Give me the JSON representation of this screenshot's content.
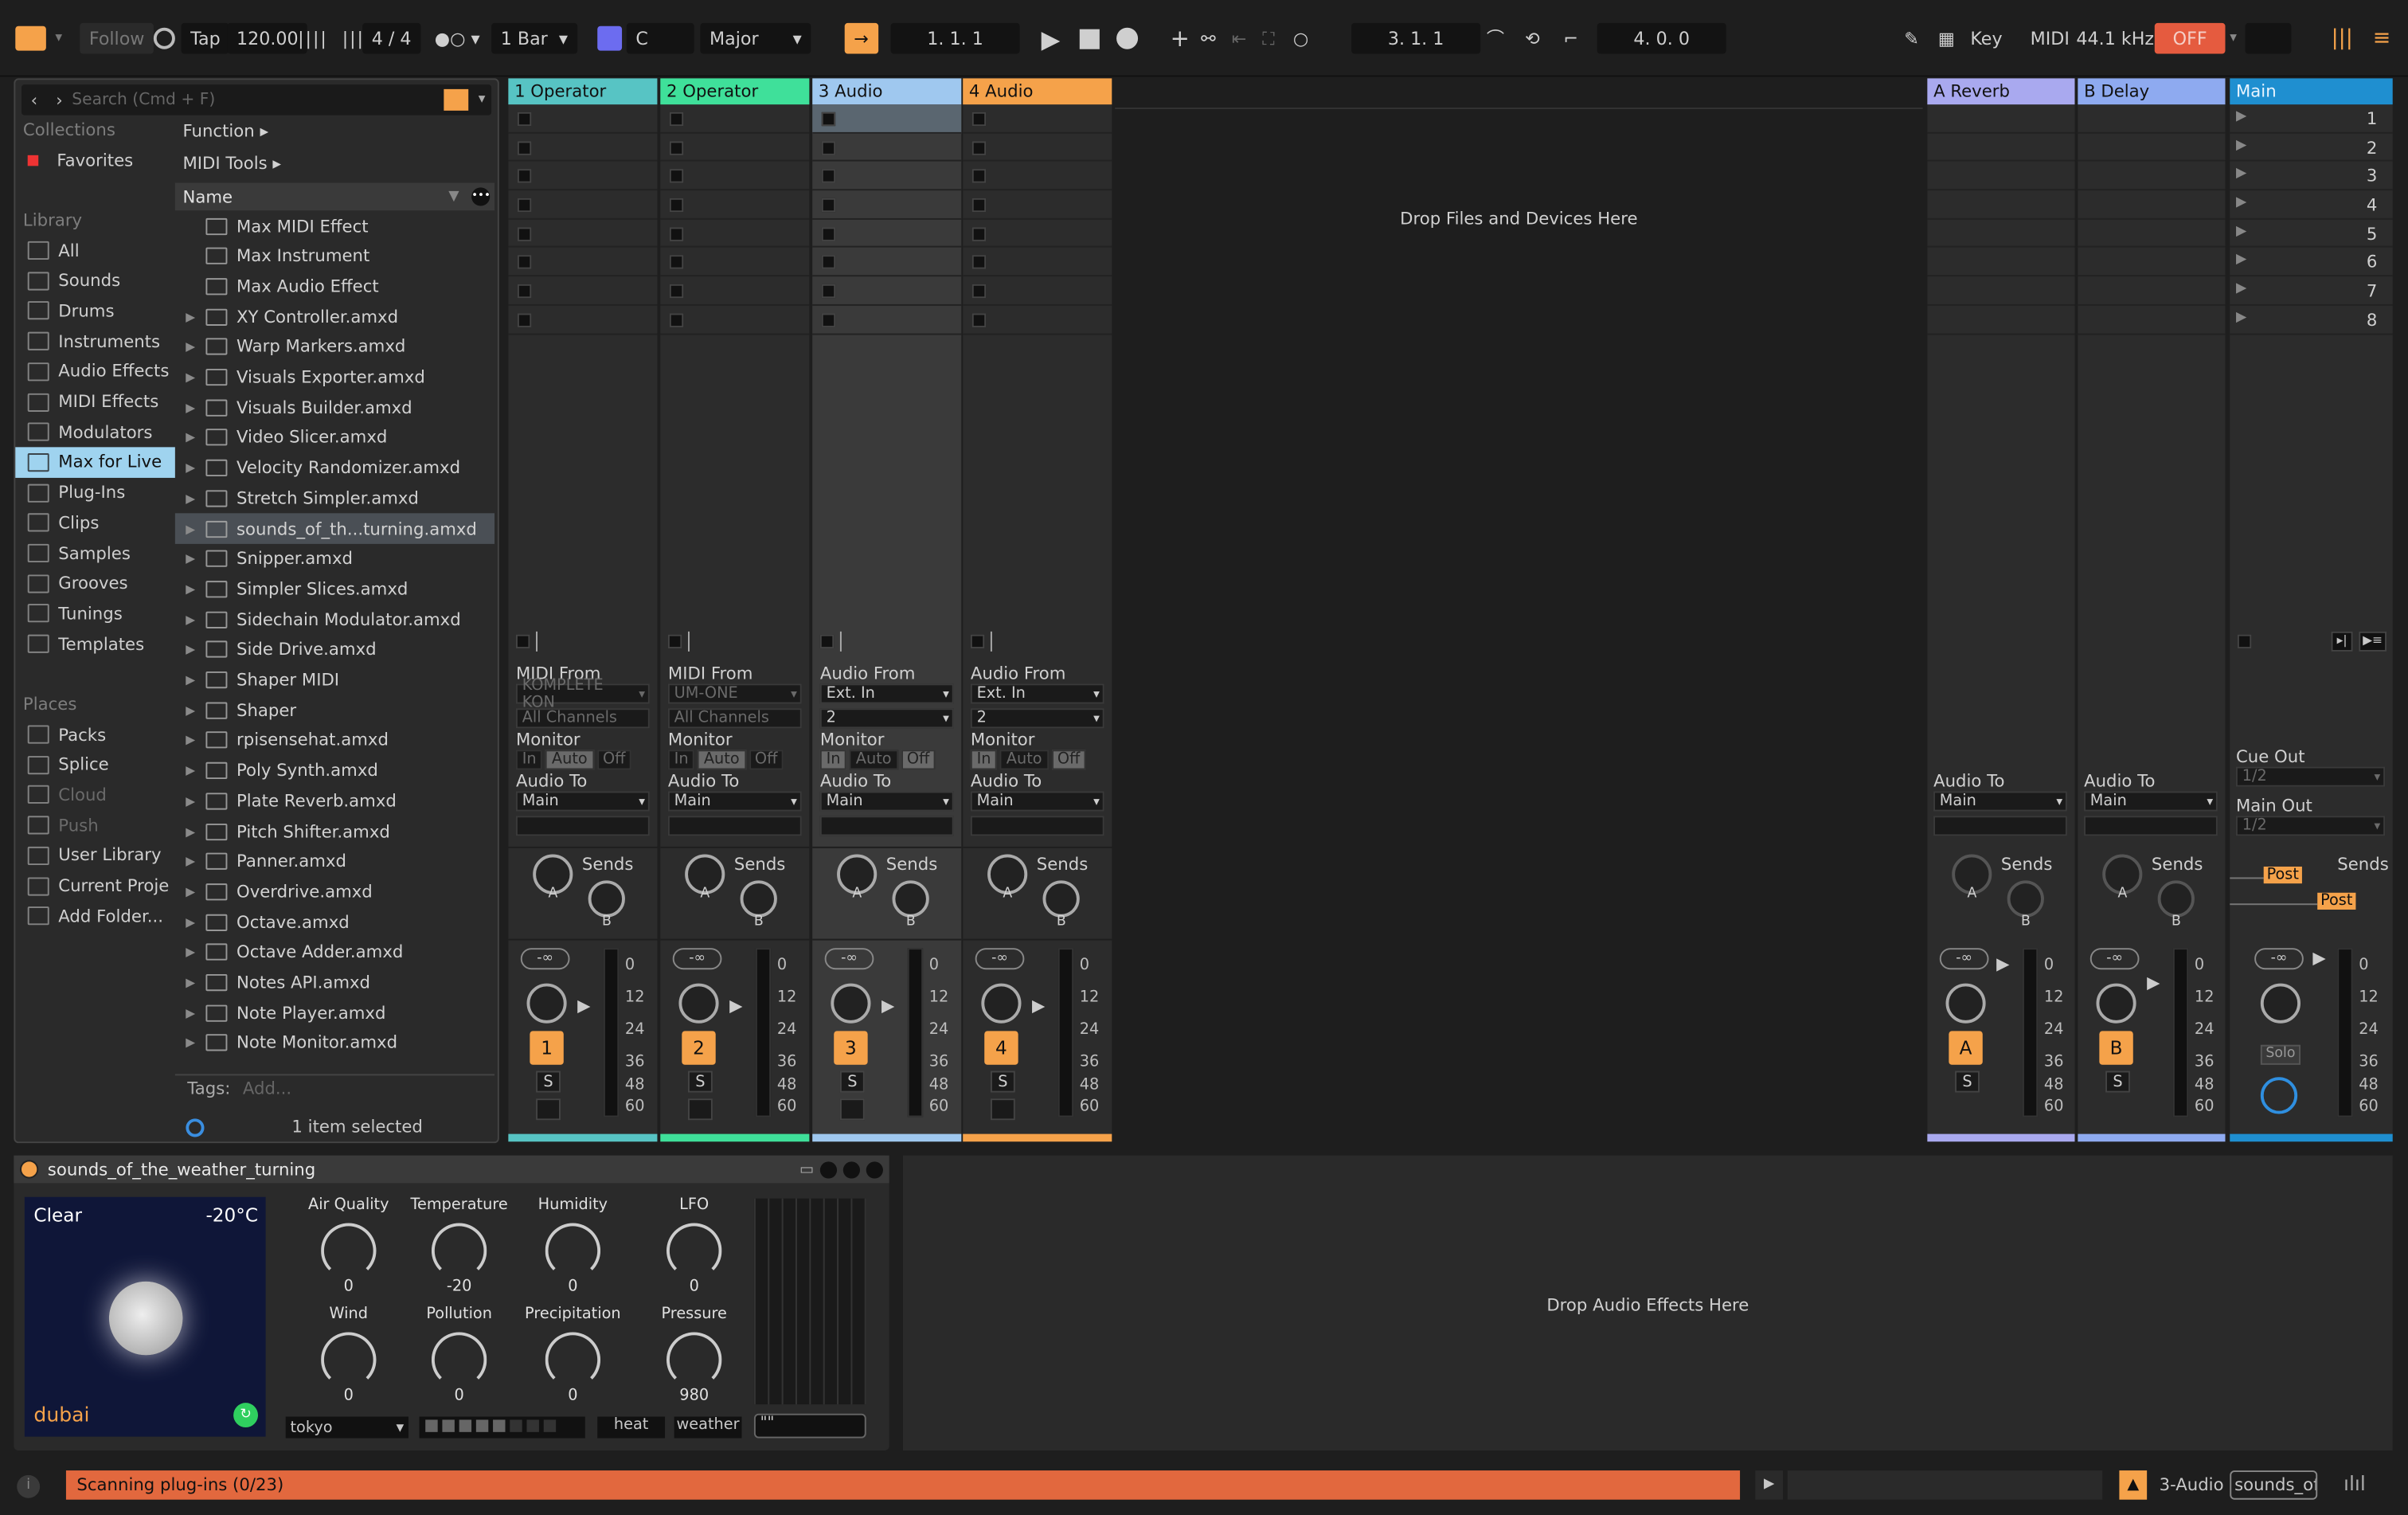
{
  "transport": {
    "follow": "Follow",
    "tap": "Tap",
    "tempo": "120.00",
    "signature": "4 / 4",
    "quantize": "1 Bar",
    "key": "C",
    "scale": "Major",
    "position": "1.  1.  1",
    "loop_start": "3.  1.  1",
    "loop_length": "4.  0.  0",
    "key_label": "Key",
    "midi_label": "MIDI",
    "sample_rate": "44.1 kHz",
    "cpu_label": "OFF"
  },
  "browser": {
    "search_placeholder": "Search (Cmd + F)",
    "collections_header": "Collections",
    "favorites": "Favorites",
    "library_header": "Library",
    "library_items": [
      "All",
      "Sounds",
      "Drums",
      "Instruments",
      "Audio Effects",
      "MIDI Effects",
      "Modulators",
      "Max for Live",
      "Plug-Ins",
      "Clips",
      "Samples",
      "Grooves",
      "Tunings",
      "Templates"
    ],
    "places_header": "Places",
    "places_items": [
      "Packs",
      "Splice",
      "Cloud",
      "Push",
      "User Library",
      "Current Proje",
      "Add Folder..."
    ],
    "filters": [
      "Function ▸",
      "MIDI Tools ▸"
    ],
    "name_header": "Name",
    "files": [
      "Max MIDI Effect",
      "Max Instrument",
      "Max Audio Effect",
      "XY Controller.amxd",
      "Warp Markers.amxd",
      "Visuals Exporter.amxd",
      "Visuals Builder.amxd",
      "Video Slicer.amxd",
      "Velocity Randomizer.amxd",
      "Stretch Simpler.amxd",
      "sounds_of_th...turning.amxd",
      "Snipper.amxd",
      "Simpler Slices.amxd",
      "Sidechain Modulator.amxd",
      "Side Drive.amxd",
      "Shaper MIDI",
      "Shaper",
      "rpisensehat.amxd",
      "Poly Synth.amxd",
      "Plate Reverb.amxd",
      "Pitch Shifter.amxd",
      "Panner.amxd",
      "Overdrive.amxd",
      "Octave.amxd",
      "Octave Adder.amxd",
      "Notes API.amxd",
      "Note Player.amxd",
      "Note Monitor.amxd"
    ],
    "tags_label": "Tags:",
    "tags_placeholder": "Add...",
    "selection_status": "1 item selected"
  },
  "tracks": [
    {
      "name": "1 Operator",
      "color": "#57c4c4",
      "from_label": "MIDI From",
      "from": "KOMPLETE KON",
      "channel": "All Channels",
      "monitor": "Monitor",
      "audio_to_label": "Audio To",
      "audio_to": "Main",
      "num": "1",
      "vol": "-∞"
    },
    {
      "name": "2 Operator",
      "color": "#3fe09a",
      "from_label": "MIDI From",
      "from": "UM-ONE",
      "channel": "All Channels",
      "monitor": "Monitor",
      "audio_to_label": "Audio To",
      "audio_to": "Main",
      "num": "2",
      "vol": "-∞"
    },
    {
      "name": "3 Audio",
      "color": "#9fc8ef",
      "from_label": "Audio From",
      "from": "Ext. In",
      "channel": "2",
      "monitor": "Monitor",
      "audio_to_label": "Audio To",
      "audio_to": "Main",
      "num": "3",
      "vol": "-∞"
    },
    {
      "name": "4 Audio",
      "color": "#f5a24a",
      "from_label": "Audio From",
      "from": "Ext. In",
      "channel": "2",
      "monitor": "Monitor",
      "audio_to_label": "Audio To",
      "audio_to": "Main",
      "num": "4",
      "vol": "-∞"
    }
  ],
  "monitor_opts": [
    "In",
    "Auto",
    "Off"
  ],
  "returns": [
    {
      "name": "A Reverb",
      "color": "#a9a9ef",
      "audio_to_label": "Audio To",
      "audio_to": "Main",
      "num": "A",
      "vol": "-∞"
    },
    {
      "name": "B Delay",
      "color": "#8eaaf0",
      "audio_to_label": "Audio To",
      "audio_to": "Main",
      "num": "B",
      "vol": "-∞"
    }
  ],
  "main": {
    "name": "Main",
    "color": "#1f8fd0",
    "cue_label": "Cue Out",
    "cue": "1/2",
    "main_label": "Main Out",
    "main_out": "1/2",
    "post": "Post",
    "vol": "-∞",
    "solo": "Solo"
  },
  "scenes": [
    "1",
    "2",
    "3",
    "4",
    "5",
    "6",
    "7",
    "8"
  ],
  "sends_label": "Sends",
  "send_a": "A",
  "send_b": "B",
  "solo_btn": "S",
  "meter_scale": [
    "0",
    "12",
    "24",
    "36",
    "48",
    "60"
  ],
  "drop_files": "Drop Files and Devices Here",
  "drop_effects": "Drop Audio Effects Here",
  "device": {
    "title": "sounds_of_the_weather_turning",
    "condition": "Clear",
    "temp_display": "-20°C",
    "city": "dubai",
    "knobs_row1": [
      {
        "label": "Air Quality",
        "value": "0"
      },
      {
        "label": "Temperature",
        "value": "-20"
      },
      {
        "label": "Humidity",
        "value": "0"
      },
      {
        "label": "LFO",
        "value": "0"
      }
    ],
    "knobs_row2": [
      {
        "label": "Wind",
        "value": "0"
      },
      {
        "label": "Pollution",
        "value": "0"
      },
      {
        "label": "Precipitation",
        "value": "0"
      },
      {
        "label": "Pressure",
        "value": "980"
      }
    ],
    "city_select": "tokyo",
    "heat": "heat",
    "weather": "weather",
    "text_field": "\"\""
  },
  "status": {
    "message": "Scanning plug-ins (0/23)",
    "track": "3-Audio",
    "device": "sounds_of"
  }
}
